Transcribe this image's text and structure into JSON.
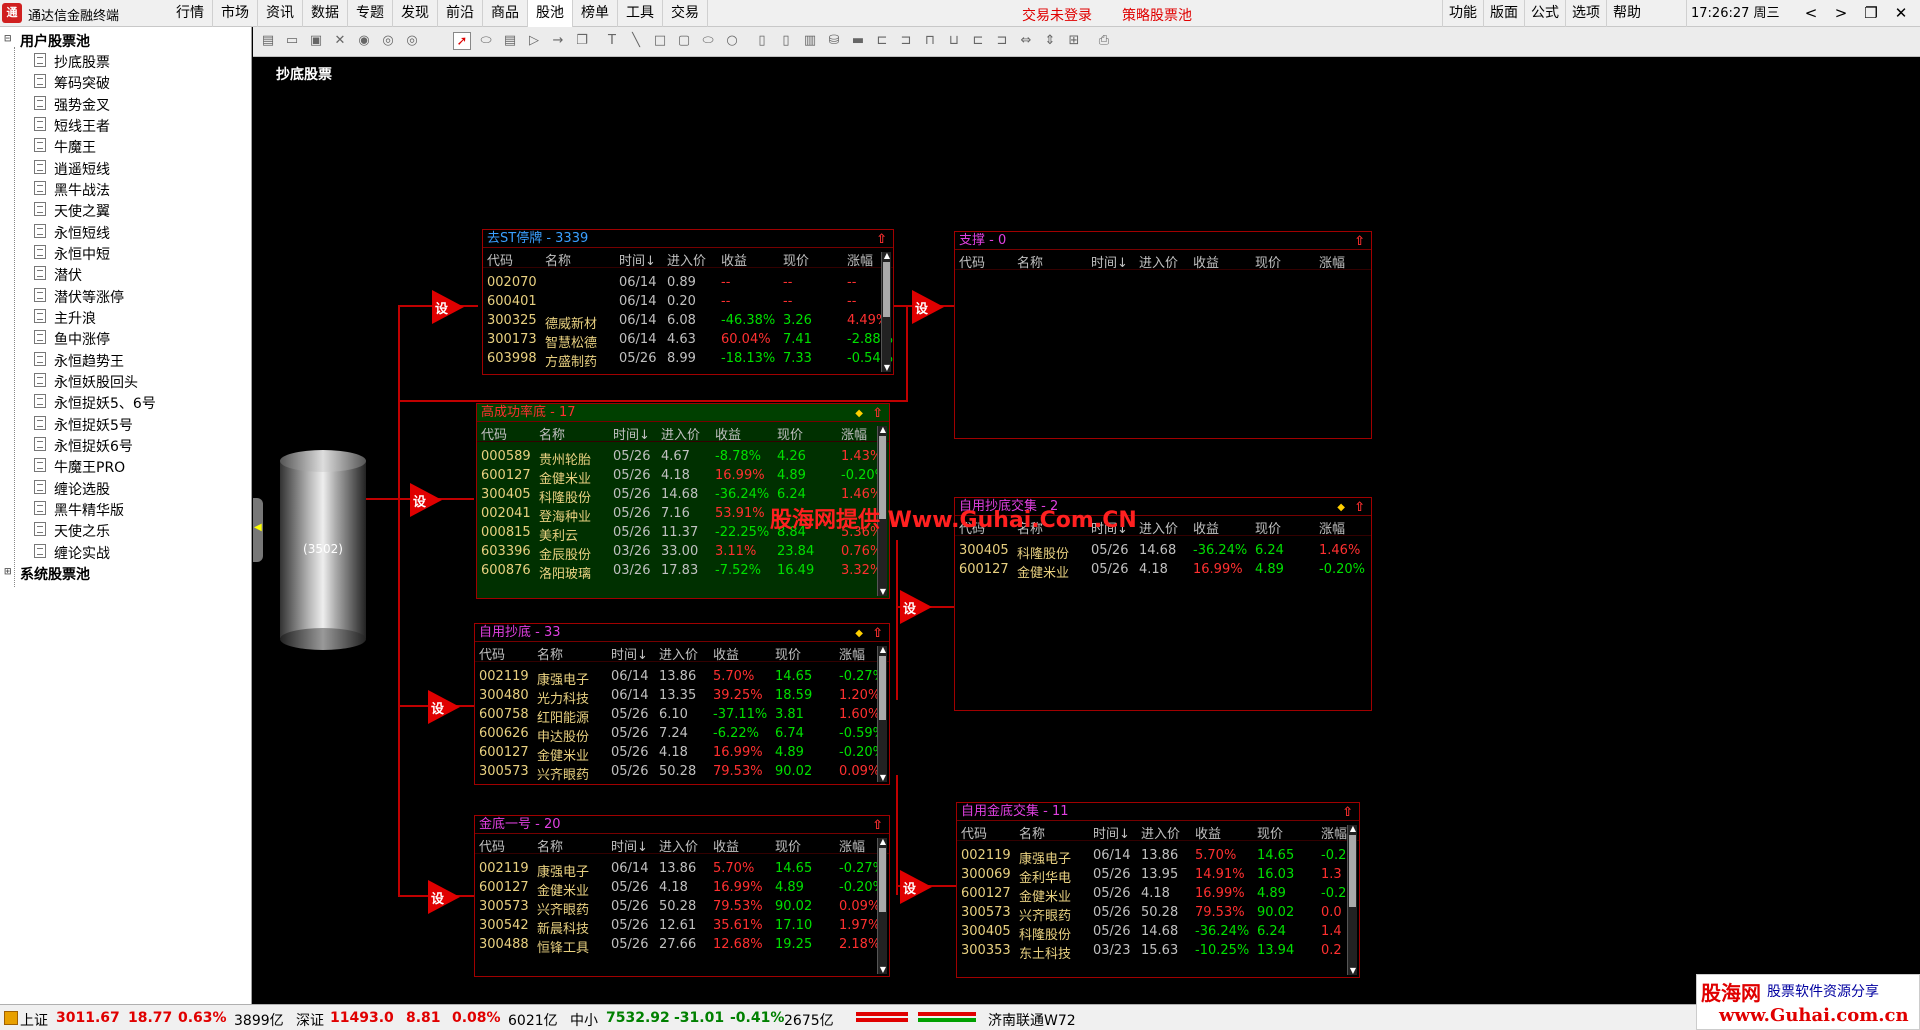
{
  "app": {
    "title": "通达信金融终端",
    "logo_glyph": "通"
  },
  "menus": [
    "行情",
    "市场",
    "资讯",
    "数据",
    "专题",
    "发现",
    "前沿",
    "商品",
    "股池",
    "榜单",
    "工具",
    "交易"
  ],
  "active_menu": "股池",
  "alerts": {
    "trade_login": "交易未登录",
    "strategy_pool": "策略股票池"
  },
  "right_menus": [
    "功能",
    "版面",
    "公式",
    "选项",
    "帮助"
  ],
  "clock": "17:26:27 周三",
  "window_controls": [
    "<",
    ">",
    "❐",
    "✕"
  ],
  "sidebar": {
    "user_root": "用户股票池",
    "system_root": "系统股票池",
    "items": [
      "抄底股票",
      "筹码突破",
      "强势金叉",
      "短线王者",
      "牛魔王",
      "逍遥短线",
      "黑牛战法",
      "天使之翼",
      "永恒短线",
      "永恒中短",
      "潜伏",
      "潜伏等涨停",
      "主升浪",
      "鱼中涨停",
      "永恒趋势王",
      "永恒妖股回头",
      "永恒捉妖5、6号",
      "永恒捉妖5号",
      "永恒捉妖6号",
      "牛魔王PRO",
      "缠论选股",
      "黑牛精华版",
      "天使之乐",
      "缠论实战"
    ]
  },
  "page_heading": "抄底股票",
  "source_label": "(3502)",
  "trigger_label": "设",
  "columns": [
    "代码",
    "名称",
    "时间↓",
    "进入价",
    "收益",
    "现价",
    "涨幅"
  ],
  "panels": {
    "p1": {
      "title": "去ST停牌 - 3339",
      "rows": [
        [
          "002070",
          "",
          "06/14",
          "0.89",
          "--",
          "--",
          "--"
        ],
        [
          "600401",
          "",
          "06/14",
          "0.20",
          "--",
          "--",
          "--"
        ],
        [
          "300325",
          "德威新材",
          "06/14",
          "6.08",
          "-46.38%",
          "3.26",
          "4.49%"
        ],
        [
          "300173",
          "智慧松德",
          "06/14",
          "4.63",
          "60.04%",
          "7.41",
          "-2.88%"
        ],
        [
          "603998",
          "方盛制药",
          "05/26",
          "8.99",
          "-18.13%",
          "7.33",
          "-0.54%"
        ]
      ]
    },
    "p2": {
      "title": "高成功率底 - 17",
      "rows": [
        [
          "000589",
          "贵州轮胎",
          "05/26",
          "4.67",
          "-8.78%",
          "4.26",
          "1.43%"
        ],
        [
          "600127",
          "金健米业",
          "05/26",
          "4.18",
          "16.99%",
          "4.89",
          "-0.20%"
        ],
        [
          "300405",
          "科隆股份",
          "05/26",
          "14.68",
          "-36.24%",
          "6.24",
          "1.46%"
        ],
        [
          "002041",
          "登海种业",
          "05/26",
          "7.16",
          "53.91%",
          "",
          ""
        ],
        [
          "000815",
          "美利云",
          "05/26",
          "11.37",
          "-22.25%",
          "8.84",
          "5.36%"
        ],
        [
          "603396",
          "金辰股份",
          "03/26",
          "33.00",
          "3.11%",
          "23.84",
          "0.76%"
        ],
        [
          "600876",
          "洛阳玻璃",
          "03/26",
          "17.83",
          "-7.52%",
          "16.49",
          "3.32%"
        ]
      ]
    },
    "p3": {
      "title": "自用抄底 - 33",
      "rows": [
        [
          "002119",
          "康强电子",
          "06/14",
          "13.86",
          "5.70%",
          "14.65",
          "-0.27%"
        ],
        [
          "300480",
          "光力科技",
          "06/14",
          "13.35",
          "39.25%",
          "18.59",
          "1.20%"
        ],
        [
          "600758",
          "红阳能源",
          "05/26",
          "6.10",
          "-37.11%",
          "3.81",
          "1.60%"
        ],
        [
          "600626",
          "申达股份",
          "05/26",
          "7.24",
          "-6.22%",
          "6.74",
          "-0.59%"
        ],
        [
          "600127",
          "金健米业",
          "05/26",
          "4.18",
          "16.99%",
          "4.89",
          "-0.20%"
        ],
        [
          "300573",
          "兴齐眼药",
          "05/26",
          "50.28",
          "79.53%",
          "90.02",
          "0.09%"
        ]
      ]
    },
    "p4": {
      "title": "金底一号 - 20",
      "rows": [
        [
          "002119",
          "康强电子",
          "06/14",
          "13.86",
          "5.70%",
          "14.65",
          "-0.27%"
        ],
        [
          "600127",
          "金健米业",
          "05/26",
          "4.18",
          "16.99%",
          "4.89",
          "-0.20%"
        ],
        [
          "300573",
          "兴齐眼药",
          "05/26",
          "50.28",
          "79.53%",
          "90.02",
          "0.09%"
        ],
        [
          "300542",
          "新晨科技",
          "05/26",
          "12.61",
          "35.61%",
          "17.10",
          "1.97%"
        ],
        [
          "300488",
          "恒锋工具",
          "05/26",
          "27.66",
          "12.68%",
          "19.25",
          "2.18%"
        ]
      ]
    },
    "p5": {
      "title": "支撑 - 0",
      "rows": []
    },
    "p6": {
      "title": "自用抄底交集 - 2",
      "rows": [
        [
          "300405",
          "科隆股份",
          "05/26",
          "14.68",
          "-36.24%",
          "6.24",
          "1.46%"
        ],
        [
          "600127",
          "金健米业",
          "05/26",
          "4.18",
          "16.99%",
          "4.89",
          "-0.20%"
        ]
      ]
    },
    "p7": {
      "title": "自用金底交集 - 11",
      "rows": [
        [
          "002119",
          "康强电子",
          "06/14",
          "13.86",
          "5.70%",
          "14.65",
          "-0.2"
        ],
        [
          "300069",
          "金利华电",
          "05/26",
          "13.95",
          "14.91%",
          "16.03",
          "1.3"
        ],
        [
          "600127",
          "金健米业",
          "05/26",
          "4.18",
          "16.99%",
          "4.89",
          "-0.2"
        ],
        [
          "300573",
          "兴齐眼药",
          "05/26",
          "50.28",
          "79.53%",
          "90.02",
          "0.0"
        ],
        [
          "300405",
          "科隆股份",
          "05/26",
          "14.68",
          "-36.24%",
          "6.24",
          "1.4"
        ],
        [
          "300353",
          "东土科技",
          "03/23",
          "15.63",
          "-10.25%",
          "13.94",
          "0.2"
        ]
      ]
    }
  },
  "watermark": "股海网提供 Www.Guhai.Com.CN",
  "status": {
    "sh_label": "上证",
    "sh_value": "3011.67",
    "sh_change": "18.77",
    "sh_pct": "0.63%",
    "sh_amount": "3899亿",
    "sz_label": "深证",
    "sz_value": "11493.0",
    "sz_change": "8.81",
    "sz_pct": "0.08%",
    "sz_amount": "6021亿",
    "zx_label": "中小",
    "zx_value": "7532.92",
    "zx_change": "-31.01",
    "zx_pct": "-0.41%",
    "zx_amount": "2675亿",
    "connection": "济南联通W72"
  },
  "brand": {
    "name": "股海网",
    "tagline": "股票软件资源分享",
    "url": "www.Guhai.com.cn"
  },
  "colors": {
    "up": "#ff3030",
    "down": "#00e000",
    "frame": "#a00000",
    "code": "#e8d080"
  }
}
